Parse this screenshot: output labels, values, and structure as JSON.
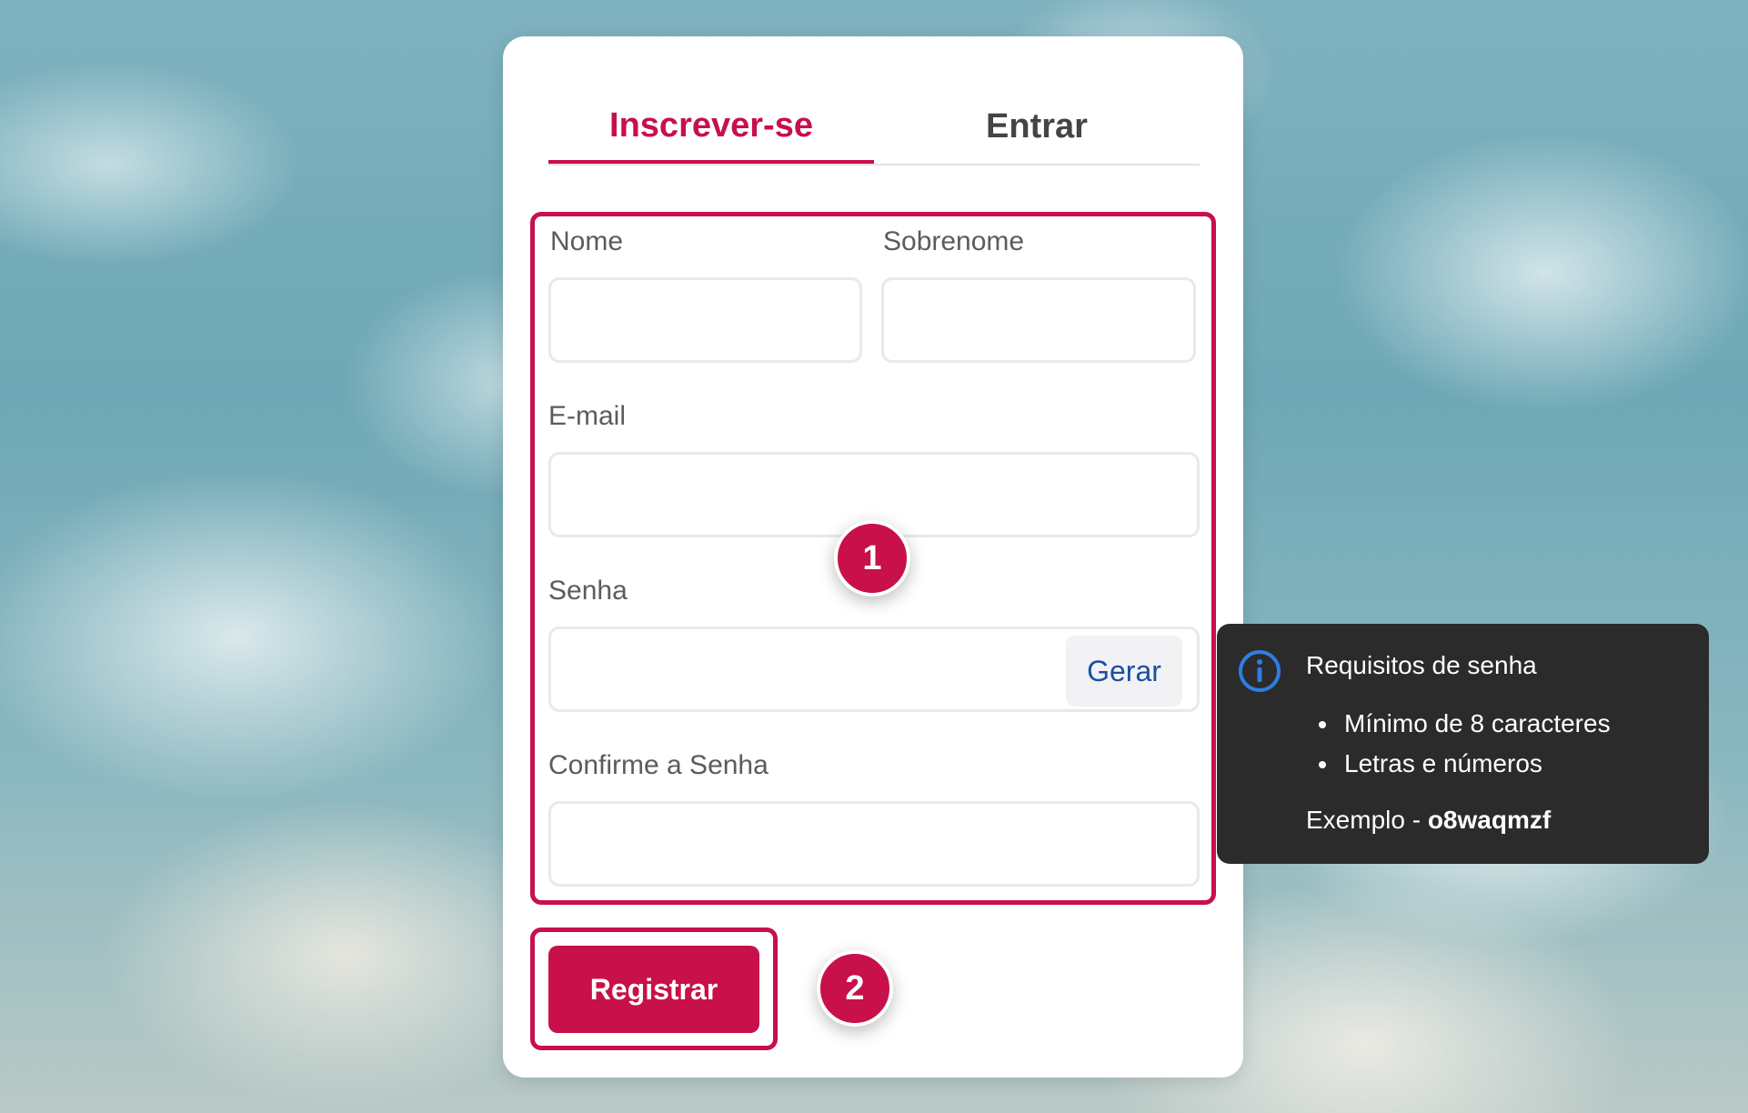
{
  "tabs": {
    "signup": "Inscrever-se",
    "login": "Entrar"
  },
  "form": {
    "first_name_label": "Nome",
    "last_name_label": "Sobrenome",
    "email_label": "E-mail",
    "password_label": "Senha",
    "generate_label": "Gerar",
    "confirm_password_label": "Confirme a Senha",
    "first_name_value": "",
    "last_name_value": "",
    "email_value": "",
    "password_value": "",
    "confirm_password_value": ""
  },
  "submit_label": "Registrar",
  "badges": {
    "one": "1",
    "two": "2"
  },
  "tooltip": {
    "title": "Requisitos de senha",
    "requirements": [
      "Mínimo de 8 caracteres",
      "Letras e números"
    ],
    "example_prefix": "Exemplo - ",
    "example_value": "o8waqmzf"
  },
  "icons": {
    "tooltip": "info-icon"
  },
  "colors": {
    "accent": "#c8104a",
    "link": "#1b4fa0",
    "tooltip_bg": "#2b2b2c",
    "info_icon": "#2f7de1"
  }
}
